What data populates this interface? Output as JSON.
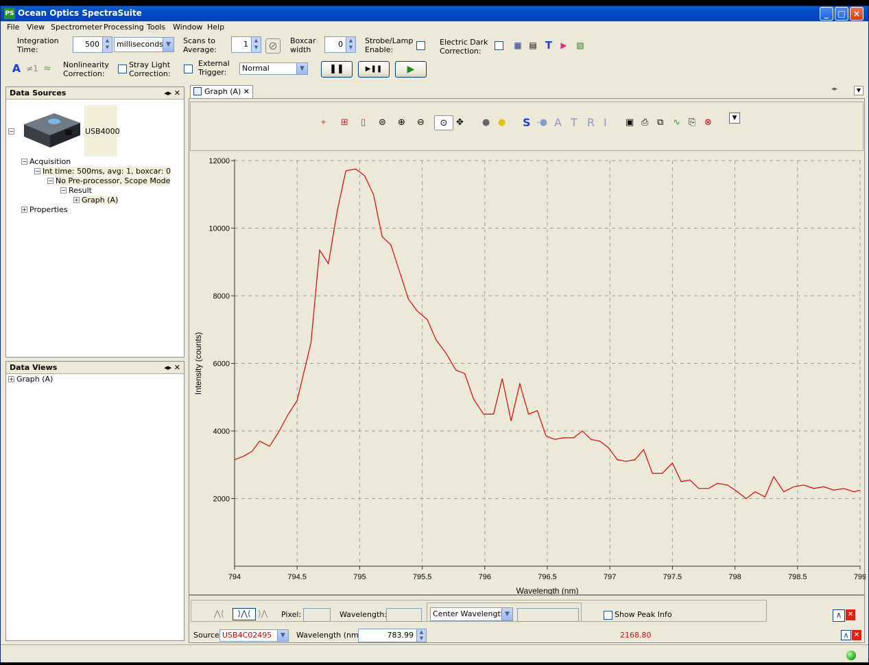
{
  "app": {
    "title": "Ocean Optics SpectraSuite",
    "icon_text": "PS"
  },
  "menu": [
    "File",
    "View",
    "Spectrometer",
    "Processing",
    "Tools",
    "Window",
    "Help"
  ],
  "toolbar": {
    "integration_label": "Integration Time:",
    "integration_value": "500",
    "integration_unit": "milliseconds",
    "scans_label": "Scans to Average:",
    "scans_value": "1",
    "boxcar_label": "Boxcar width",
    "boxcar_value": "0",
    "strobe_label": "Strobe/Lamp Enable:",
    "electric_dark_label": "Electric Dark Correction:",
    "nonlinearity_label": "Nonlinearity Correction:",
    "stray_light_label": "Stray Light Correction:",
    "external_trigger_label": "External Trigger:",
    "trigger_mode": "Normal",
    "pause_glyph": "❚❚",
    "step_glyph": "▶❚❚",
    "play_glyph": "▶"
  },
  "data_sources": {
    "title": "Data Sources",
    "device": "USB4000",
    "acquisition": "Acquisition",
    "int_time": "Int time: 500ms, avg: 1, boxcar: 0",
    "preprocessor": "No Pre-processor, Scope Mode",
    "result": "Result",
    "graph": "Graph (A)",
    "properties": "Properties"
  },
  "data_views": {
    "title": "Data Views",
    "graph": "Graph (A)"
  },
  "graph_tab": {
    "label": "Graph (A)",
    "letters": [
      "S",
      "A",
      "T",
      "R",
      "I"
    ]
  },
  "chart_data": {
    "type": "line",
    "xlabel": "Wavelength (nm)",
    "ylabel": "Intensity (counts)",
    "xlim": [
      794,
      799
    ],
    "ylim": [
      0,
      12000
    ],
    "x_ticks": [
      "794",
      "794.5",
      "795",
      "795.5",
      "796",
      "796.5",
      "797",
      "797.5",
      "798",
      "798.5",
      "799"
    ],
    "y_ticks": [
      "2000",
      "4000",
      "6000",
      "8000",
      "10000",
      "12000"
    ],
    "grid": true,
    "line_color": "#e00000",
    "series": [
      {
        "x": [
          794.0,
          794.07,
          794.14,
          794.2,
          794.28,
          794.35,
          794.43,
          794.5,
          794.61,
          794.68,
          794.75,
          794.82,
          794.89,
          794.97,
          795.04,
          795.11,
          795.18,
          795.25,
          795.32,
          795.39,
          795.46,
          795.54,
          795.61,
          795.69,
          795.77,
          795.84,
          795.91,
          795.99,
          796.07,
          796.14,
          796.21,
          796.28,
          796.35,
          796.42,
          796.49,
          796.56,
          796.63,
          796.71,
          796.78,
          796.85,
          796.92,
          796.99,
          797.06,
          797.13,
          797.2,
          797.27,
          797.34,
          797.42,
          797.5,
          797.57,
          797.64,
          797.71,
          797.79,
          797.86,
          797.94,
          798.02,
          798.09,
          798.16,
          798.24,
          798.31,
          798.39,
          798.47,
          798.55,
          798.63,
          798.71,
          798.79,
          798.87,
          798.95,
          799.0
        ],
        "y": [
          3150,
          3250,
          3400,
          3700,
          3550,
          3950,
          4500,
          4900,
          6600,
          9350,
          8950,
          10500,
          11700,
          11750,
          11550,
          11000,
          9750,
          9500,
          8700,
          7900,
          7550,
          7300,
          6700,
          6300,
          5800,
          5700,
          4950,
          4500,
          4500,
          5550,
          4300,
          5400,
          4500,
          4600,
          3850,
          3750,
          3800,
          3800,
          4000,
          3750,
          3700,
          3500,
          3150,
          3100,
          3150,
          3450,
          2750,
          2750,
          3050,
          2500,
          2550,
          2300,
          2300,
          2450,
          2400,
          2200,
          2000,
          2200,
          2050,
          2650,
          2200,
          2350,
          2400,
          2300,
          2350,
          2250,
          2300,
          2200,
          2250
        ]
      }
    ]
  },
  "bottom": {
    "pixel_label": "Pixel:",
    "wavelength_label": "Wavelength:",
    "center_wavelength": "Center Wavelength",
    "show_peak_info": "Show Peak Info",
    "source_label": "Source:",
    "source_value": "USB4C02495",
    "wavelength_nm_label": "Wavelength (nm):",
    "wavelength_nm_value": "783.99",
    "readout": "2168.80"
  }
}
